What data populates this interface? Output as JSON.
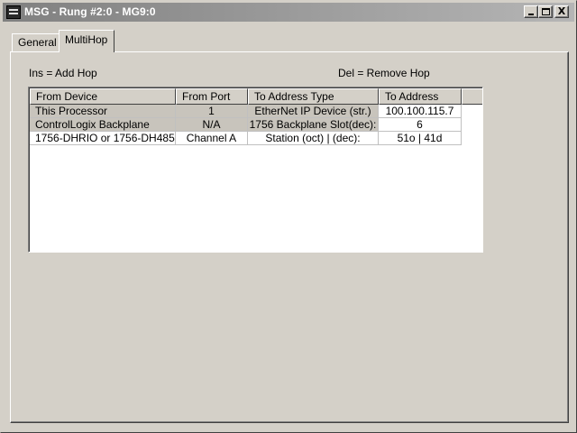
{
  "window": {
    "title": "MSG - Rung #2:0 - MG9:0",
    "buttons": {
      "minimize": "_",
      "maximize": "□",
      "close": "X"
    }
  },
  "tabs": [
    {
      "label": "General",
      "active": false
    },
    {
      "label": "MultiHop",
      "active": true
    }
  ],
  "hints": {
    "add": "Ins = Add Hop",
    "remove": "Del = Remove Hop"
  },
  "table": {
    "columns": [
      "From Device",
      "From Port",
      "To Address Type",
      "To Address"
    ],
    "rows": [
      {
        "from_device": "This Processor",
        "from_port": "1",
        "to_address_type": "EtherNet IP Device (str.)",
        "to_address": "100.100.115.7"
      },
      {
        "from_device": "ControlLogix Backplane",
        "from_port": "N/A",
        "to_address_type": "1756 Backplane Slot(dec):",
        "to_address": "6"
      },
      {
        "from_device": "1756-DHRIO or 1756-DH485",
        "from_port": "Channel A",
        "to_address_type": "Station (oct) | (dec):",
        "to_address": "51o | 41d"
      }
    ]
  },
  "colors": {
    "face": "#d4d0c8",
    "title_gradient_start": "#808080",
    "title_gradient_end": "#b5b5b5",
    "row_shaded": "#c8c4bc"
  },
  "icons": {
    "app": "msg-app-icon",
    "minimize": "minimize-icon",
    "maximize": "maximize-icon",
    "close": "close-icon"
  }
}
